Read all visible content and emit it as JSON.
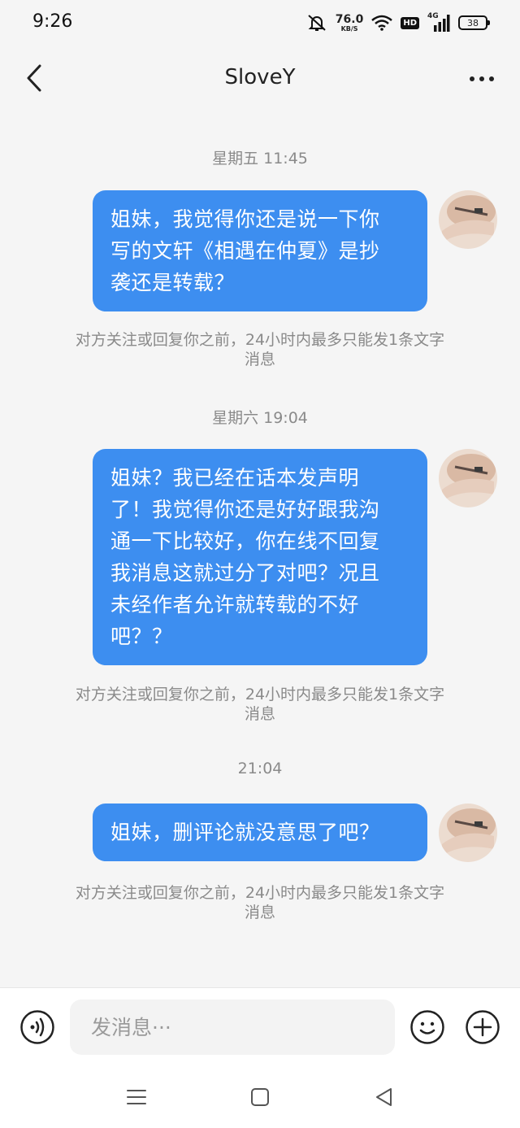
{
  "status_bar": {
    "time": "9:26",
    "net_speed": "76.0",
    "net_unit": "KB/S",
    "hd": "HD",
    "signal_type": "4G",
    "battery": "38"
  },
  "header": {
    "title": "SloveY"
  },
  "messages": [
    {
      "timestamp": "星期五 11:45",
      "lines": [
        "姐妹，我觉得你还是说一下你",
        "写的文轩《相遇在仲夏》是抄",
        "袭还是转载？"
      ],
      "notice_lines": [
        "对方关注或回复你之前，24小时内最多只能发1条文字",
        "消息"
      ]
    },
    {
      "timestamp": "星期六 19:04",
      "lines": [
        "姐妹？我已经在话本发声明",
        "了！我觉得你还是好好跟我沟",
        "通一下比较好，你在线不回复",
        "我消息这就过分了对吧？况且",
        "未经作者允许就转载的不好",
        "吧？？"
      ],
      "notice_lines": [
        "对方关注或回复你之前，24小时内最多只能发1条文字",
        "消息"
      ]
    },
    {
      "timestamp": "21:04",
      "lines": [
        "姐妹，删评论就没意思了吧？"
      ],
      "notice_lines": [
        "对方关注或回复你之前，24小时内最多只能发1条文字",
        "消息"
      ]
    }
  ],
  "input": {
    "placeholder": "发消息···"
  },
  "colors": {
    "bubble": "#3d8ef0",
    "background": "#f5f5f5",
    "muted_text": "#8a8a8a"
  }
}
